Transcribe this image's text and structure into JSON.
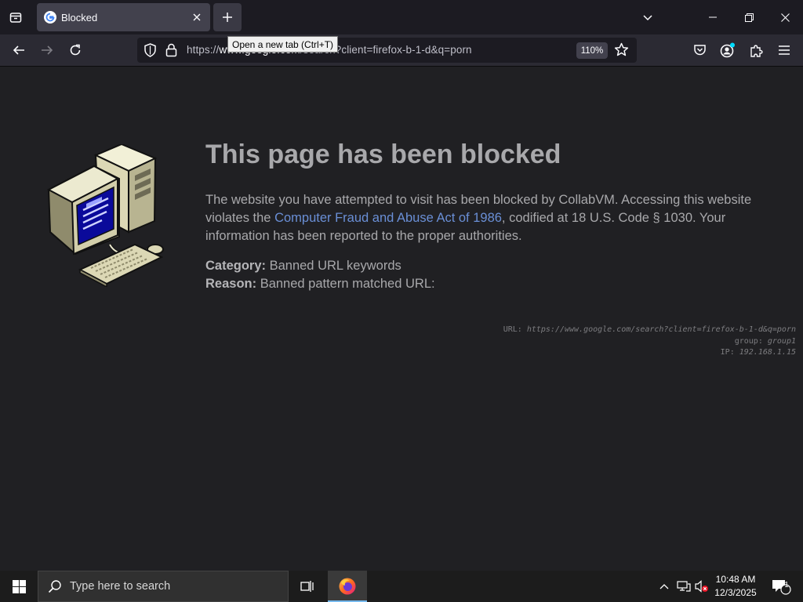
{
  "browser": {
    "tab": {
      "title": "Blocked",
      "favicon": "google-g-icon"
    },
    "tooltip": "Open a new tab (Ctrl+T)",
    "url": {
      "prefix": "https://",
      "host": "www.google.com",
      "path": "/search?client=firefox-b-1-d&q=porn"
    },
    "zoom": "110%"
  },
  "page": {
    "headline": "This page has been blocked",
    "para_before_link": "The website you have attempted to visit has been blocked by CollabVM. Accessing this website violates the ",
    "link_text": "Computer Fraud and Abuse Act of 1986",
    "para_after_link": ", codified at 18 U.S. Code § 1030. Your information has been reported to the proper authorities.",
    "category_label": "Category:",
    "category_value": " Banned URL keywords",
    "reason_label": "Reason:",
    "reason_value": " Banned pattern matched URL:",
    "debug": {
      "url_label": "URL: ",
      "url_value": "https://www.google.com/search?client=firefox-b-1-d&q=porn",
      "group_label": "group: ",
      "group_value": "group1",
      "ip_label": "IP: ",
      "ip_value": "192.168.1.15"
    }
  },
  "taskbar": {
    "search_placeholder": "Type here to search",
    "time": "10:48 AM",
    "date": "12/3/2025",
    "notification_count": "1"
  },
  "colors": {
    "link": "#6a8fd6",
    "text": "#a8a8ab",
    "accent": "#76b9ed"
  }
}
